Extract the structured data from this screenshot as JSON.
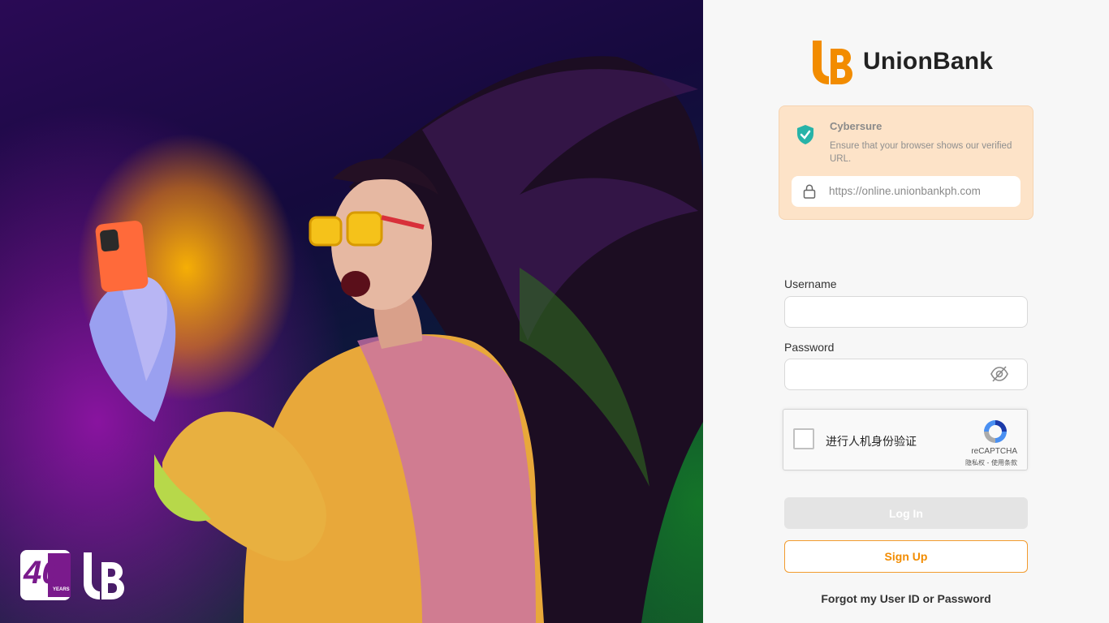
{
  "brand": {
    "name": "UnionBank",
    "accent": "#f28c00"
  },
  "cybersure": {
    "title": "Cybersure",
    "description": "Ensure that your browser shows our verified URL.",
    "url": "https://online.unionbankph.com",
    "background": "#fde3c8",
    "icon": "shield-check-icon"
  },
  "form": {
    "username_label": "Username",
    "username_value": "",
    "password_label": "Password",
    "password_value": "",
    "password_toggle_icon": "eye-off-icon"
  },
  "recaptcha": {
    "label": "进行人机身份验证",
    "brand": "reCAPTCHA",
    "terms": "隐私权 - 使用条款"
  },
  "buttons": {
    "login": "Log In",
    "signup": "Sign Up"
  },
  "links": {
    "forgot": "Forgot my User ID or Password"
  },
  "hero": {
    "badge_number": "40",
    "badge_text": "YEARS",
    "logo_text": "UB"
  }
}
